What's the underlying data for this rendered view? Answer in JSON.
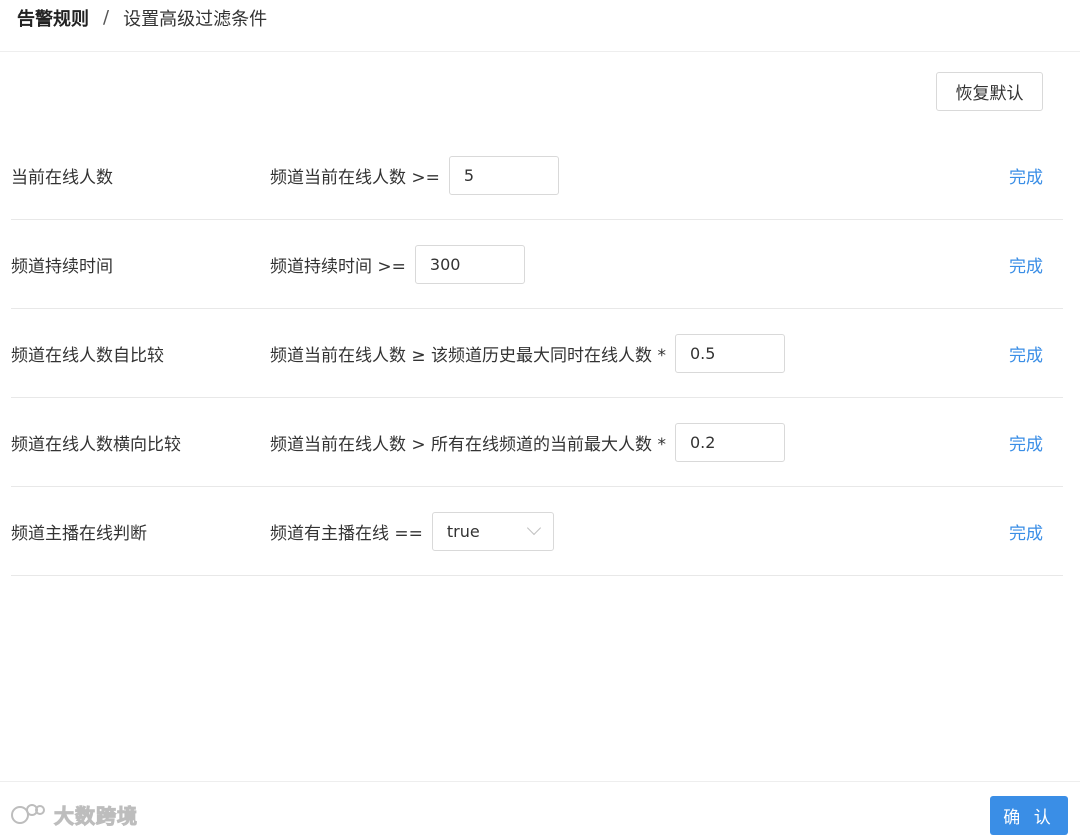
{
  "breadcrumb": {
    "root": "告警规则",
    "separator": "/",
    "current": "设置高级过滤条件"
  },
  "reset_button": "恢复默认",
  "rows": [
    {
      "label": "当前在线人数",
      "condition": "频道当前在线人数 >=",
      "value": "5",
      "action": "完成"
    },
    {
      "label": "频道持续时间",
      "condition": "频道持续时间 >=",
      "value": "300",
      "action": "完成"
    },
    {
      "label": "频道在线人数自比较",
      "condition": "频道当前在线人数 ≥ 该频道历史最大同时在线人数 *",
      "value": "0.5",
      "action": "完成"
    },
    {
      "label": "频道在线人数横向比较",
      "condition": "频道当前在线人数 > 所有在线频道的当前最大人数 *",
      "value": "0.2",
      "action": "完成"
    },
    {
      "label": "频道主播在线判断",
      "condition": "频道有主播在线 ==",
      "value": "true",
      "action": "完成"
    }
  ],
  "confirm_button": "确 认",
  "watermark": "大数跨境",
  "colors": {
    "accent": "#3a8ee6",
    "border": "#d9d9d9",
    "divider": "#e8e8e8"
  }
}
